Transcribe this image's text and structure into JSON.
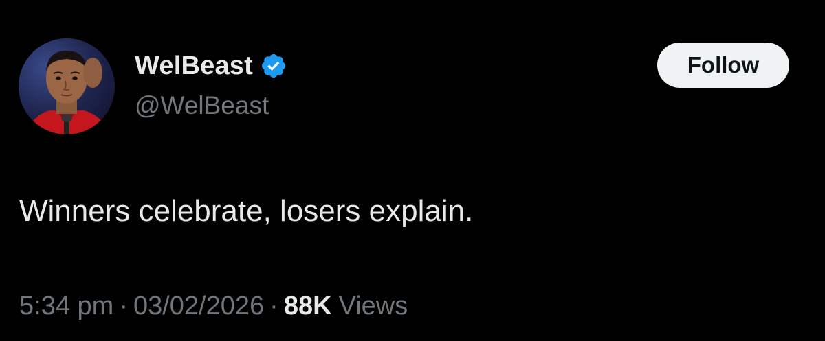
{
  "user": {
    "display_name": "WelBeast",
    "handle": "@WelBeast",
    "verified": true,
    "avatar_icon": "profile-photo"
  },
  "follow_button": {
    "label": "Follow"
  },
  "tweet": {
    "text": "Winners celebrate, losers explain."
  },
  "meta": {
    "time": "5:34 pm",
    "separator": "·",
    "date": "03/02/2026",
    "views_count": "88K",
    "views_label": "Views"
  },
  "colors": {
    "background": "#000000",
    "primary_text": "#e7e9ea",
    "secondary_text": "#71767b",
    "verified_badge": "#1d9bf0",
    "follow_button_bg": "#eff3f4"
  }
}
